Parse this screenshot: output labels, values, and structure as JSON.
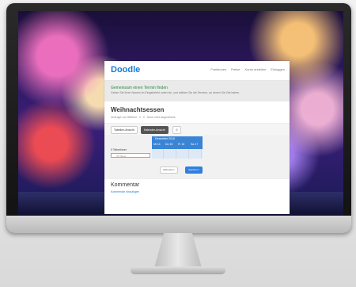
{
  "app": {
    "logo": "Doodle",
    "nav": [
      "Funktionen",
      "Preise",
      "Konto erstellen",
      "Einloggen"
    ]
  },
  "intro": {
    "heading": "Gemeinsam einen Termin finden",
    "text": "Geben Sie Ihren Namen im Eingabefeld unten ein, und wählen Sie die Termine, an denen Sie Zeit haben."
  },
  "poll": {
    "title": "Weihnachtsessen",
    "meta": "Umfrage von Wilfried · 0 · 0 · Noch nicht abgestimmt"
  },
  "tabs": [
    "Tabellen-Ansicht",
    "Kalender-Ansicht"
  ],
  "grid": {
    "month": "Dezember 2016",
    "dates": [
      "Mi 14",
      "Do 15",
      "Fr 16",
      "Sa 17"
    ],
    "participants_label": "0 Teilnehmer",
    "name_placeholder": "Ihr Name",
    "cancel_label": "Abbrechen",
    "save_label": "Speichern"
  },
  "comments": {
    "heading": "Kommentar",
    "add_label": "Kommentar hinzufügen"
  }
}
